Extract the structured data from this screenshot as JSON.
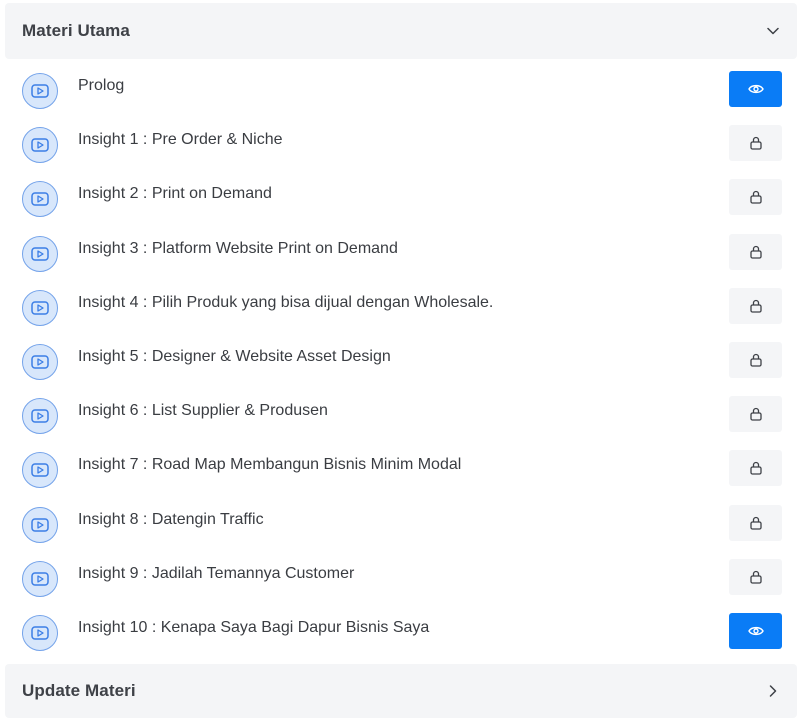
{
  "sections": {
    "main": {
      "title": "Materi Utama",
      "icon": "chevron-down-icon"
    },
    "update": {
      "title": "Update Materi",
      "icon": "chevron-right-icon"
    }
  },
  "lessons": [
    {
      "label": "Prolog",
      "status": "view",
      "icon": "video-play-icon",
      "action_icon": "eye-icon"
    },
    {
      "label": "Insight 1 : Pre Order & Niche",
      "status": "locked",
      "icon": "video-play-icon",
      "action_icon": "lock-icon"
    },
    {
      "label": "Insight 2 : Print on Demand",
      "status": "locked",
      "icon": "video-play-icon",
      "action_icon": "lock-icon"
    },
    {
      "label": "Insight 3 : Platform Website Print on Demand",
      "status": "locked",
      "icon": "video-play-icon",
      "action_icon": "lock-icon"
    },
    {
      "label": "Insight 4 : Pilih Produk yang bisa dijual dengan Wholesale.",
      "status": "locked",
      "icon": "video-play-icon",
      "action_icon": "lock-icon"
    },
    {
      "label": "Insight 5 : Designer & Website Asset Design",
      "status": "locked",
      "icon": "video-play-icon",
      "action_icon": "lock-icon"
    },
    {
      "label": "Insight 6 : List Supplier & Produsen",
      "status": "locked",
      "icon": "video-play-icon",
      "action_icon": "lock-icon"
    },
    {
      "label": "Insight 7 : Road Map Membangun Bisnis Minim Modal",
      "status": "locked",
      "icon": "video-play-icon",
      "action_icon": "lock-icon"
    },
    {
      "label": "Insight 8 : Datengin Traffic",
      "status": "locked",
      "icon": "video-play-icon",
      "action_icon": "lock-icon"
    },
    {
      "label": "Insight 9 : Jadilah Temannya Customer",
      "status": "locked",
      "icon": "video-play-icon",
      "action_icon": "lock-icon"
    },
    {
      "label": "Insight 10 : Kenapa Saya Bagi Dapur Bisnis Saya",
      "status": "view",
      "icon": "video-play-icon",
      "action_icon": "eye-icon"
    }
  ],
  "colors": {
    "accent": "#0a7cf6",
    "icon_circle_bg": "#d8e7fb",
    "icon_circle_border": "#74a3ea",
    "locked_button_bg": "#f4f5f7",
    "header_bg": "#f4f5f7"
  }
}
